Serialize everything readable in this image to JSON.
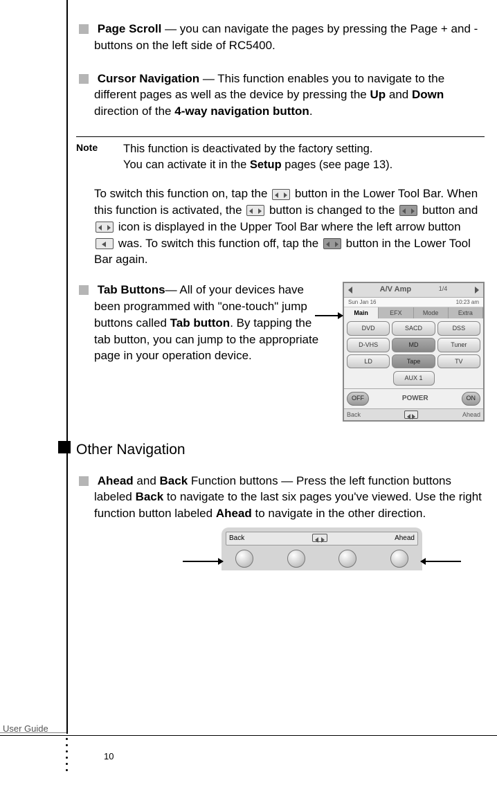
{
  "sections": {
    "pageScroll": {
      "title": "Page Scroll",
      "body": " — you can navigate the pages by pressing the Page + and - buttons on the left side of RC5400."
    },
    "cursorNav": {
      "title": "Cursor Navigation",
      "body_a": " — This function enables you to navigate to the different pages as well as the device by pressing the ",
      "up": "Up",
      "and": " and ",
      "down": "Down",
      "body_b": " direction of the ",
      "navBtn": "4-way navigation button",
      "period": "."
    },
    "note": {
      "label": "Note",
      "line1": "This function is deactivated by the factory setting.",
      "line2a": "You can activate it in the ",
      "setup": "Setup",
      "line2b": " pages (see page 13)."
    },
    "switchPara": {
      "a": "To switch this function on, tap the ",
      "b": " button in the Lower Tool Bar. When this function is activated, the ",
      "c": " button is changed to the ",
      "d": " button and ",
      "e": " icon is displayed in the Upper Tool Bar where the left arrow button ",
      "f": " was. To switch this function off, tap the ",
      "g": " button in the Lower Tool Bar again."
    },
    "tabButtons": {
      "title": "Tab Buttons",
      "body_a": "— All of your devices have been programmed with \"one-touch\" jump buttons called ",
      "tabLabel": "Tab button",
      "body_b": ". By tapping the tab button, you can jump to the appropriate page in your operation device."
    },
    "otherNav": {
      "heading": "Other Navigation",
      "ahead": "Ahead",
      "and": " and ",
      "back": "Back",
      "body_a": " Function buttons — Press the left function buttons labeled ",
      "body_b": " to navigate to the last six pages you've viewed. Use the right function button labeled ",
      "body_c": " to navigate in the other direction."
    }
  },
  "device": {
    "title": "A/V Amp",
    "page": "1/4",
    "date": "Sun Jan 16",
    "time": "10:23 am",
    "tabs": [
      "Main",
      "EFX",
      "Mode",
      "Extra"
    ],
    "buttons": [
      "DVD",
      "SACD",
      "DSS",
      "D-VHS",
      "MD",
      "Tuner",
      "LD",
      "Tape",
      "TV"
    ],
    "aux": "AUX 1",
    "off": "OFF",
    "power": "POWER",
    "on": "ON",
    "back": "Back",
    "ahead": "Ahead"
  },
  "bottomDevice": {
    "back": "Back",
    "ahead": "Ahead"
  },
  "footer": {
    "userGuide": "User Guide",
    "pageNum": "10"
  }
}
